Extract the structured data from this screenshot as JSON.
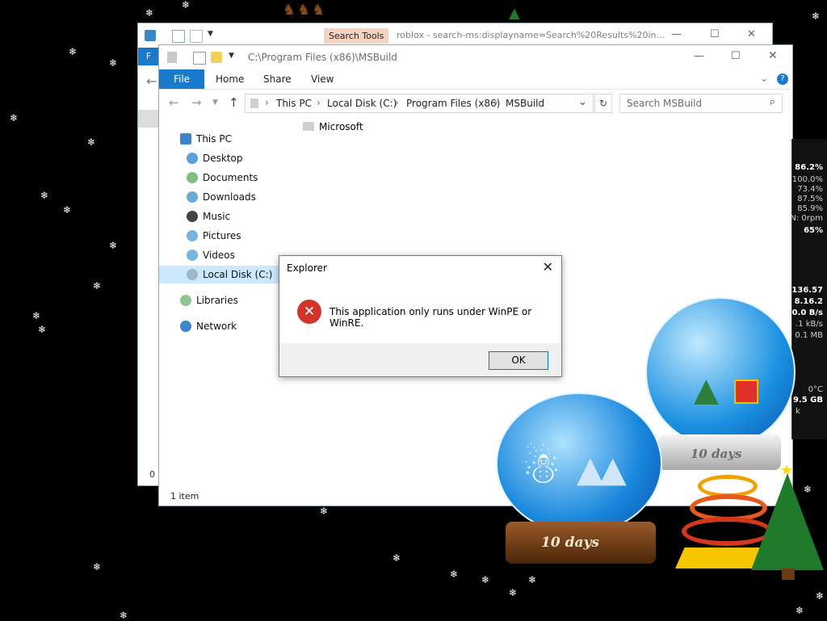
{
  "background_window": {
    "search_tools_label": "Search Tools",
    "title": "roblox - search-ms:displayname=Search%20Results%20in...",
    "ribbon_file_sliver": "F",
    "status_sliver": "0 i"
  },
  "window": {
    "title": "C:\\Program Files (x86)\\MSBuild",
    "ribbon_tabs": [
      "File",
      "Home",
      "Share",
      "View"
    ],
    "breadcrumb": [
      "This PC",
      "Local Disk (C:)",
      "Program Files (x86)",
      "MSBuild"
    ],
    "search_placeholder": "Search MSBuild",
    "nav_items": [
      {
        "label": "This PC",
        "icon": "this-pc-icon"
      },
      {
        "label": "Desktop",
        "icon": "desktop-icon"
      },
      {
        "label": "Documents",
        "icon": "documents-icon"
      },
      {
        "label": "Downloads",
        "icon": "downloads-icon"
      },
      {
        "label": "Music",
        "icon": "music-icon"
      },
      {
        "label": "Pictures",
        "icon": "pictures-icon"
      },
      {
        "label": "Videos",
        "icon": "videos-icon"
      },
      {
        "label": "Local Disk (C:)",
        "icon": "drive-icon",
        "selected": true
      },
      {
        "label": "Libraries",
        "icon": "libraries-icon"
      },
      {
        "label": "Network",
        "icon": "network-icon"
      }
    ],
    "files": [
      {
        "name": "Microsoft",
        "icon": "folder-icon"
      }
    ],
    "status": "1 item"
  },
  "dialog": {
    "title": "Explorer",
    "message": "This application only runs under WinPE or WinRE.",
    "ok_label": "OK",
    "icon": "error-icon"
  },
  "gadget_readouts": [
    "86.2%",
    "100.0%",
    "73.4%",
    "87.5%",
    "85.9%",
    "N: 0rpm",
    "65%",
    "136.57",
    "8.16.2",
    "0.0 B/s",
    ".1 kB/s",
    "0.1 MB",
    "0°C",
    "9.5 GB",
    "k"
  ],
  "decor": {
    "globe_labels": [
      "10 days",
      "10 days"
    ]
  },
  "colors": {
    "accent": "#1979ca",
    "error": "#d2342a",
    "selection": "#cce8ff",
    "desktop": "#000000"
  }
}
